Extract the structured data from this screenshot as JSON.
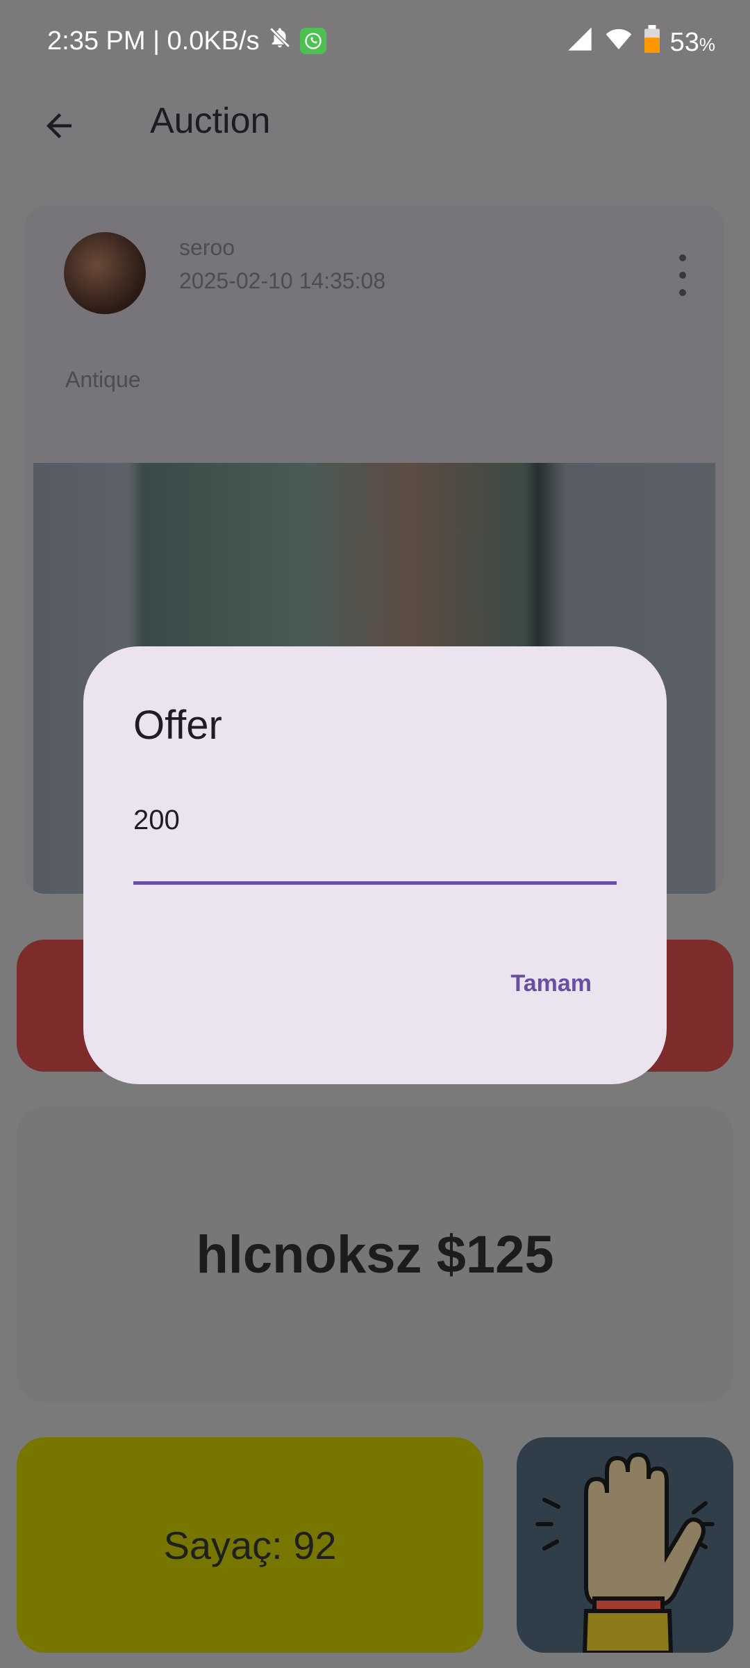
{
  "status_bar": {
    "time_net": "2:35 PM | 0.0KB/s",
    "battery": "53",
    "battery_unit": "%",
    "icons": [
      "bell-off-icon",
      "whatsapp-icon",
      "signal-icon",
      "wifi-icon",
      "battery-icon"
    ]
  },
  "app_bar": {
    "title": "Auction"
  },
  "post": {
    "username": "seroo",
    "datetime": "2025-02-10 14:35:08",
    "category": "Antique"
  },
  "highest_bid": {
    "text": "hlcnoksz $125"
  },
  "counter": {
    "text": "Sayaç: 92"
  },
  "dialog": {
    "title": "Offer",
    "input_value": "200",
    "ok_label": "Tamam"
  },
  "colors": {
    "accent": "#6750a4",
    "dialog_bg": "#ebe4ef",
    "bid_button": "#7d2b2b",
    "counter_bg": "#777700",
    "raise_hand_bg": "#2f3e48"
  }
}
